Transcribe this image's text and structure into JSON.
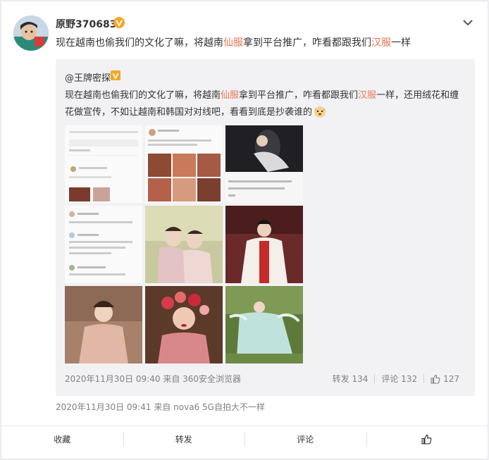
{
  "post": {
    "username": "原野370683",
    "text_parts": [
      "现在越南也偷我们的文化了嘛，将越南",
      "仙服",
      "拿到平台推广，咋看都跟我们",
      "汉服",
      "一样"
    ],
    "timestamp": "2020年11月30日 09:41",
    "source_label": "来自",
    "source": "nova6 5G自拍大不一样"
  },
  "repost": {
    "username": "@王牌密探",
    "text_parts": [
      "现在越南也偷我们的文化了嘛，将越南",
      "仙服",
      "拿到平台推广，咋看都跟我们",
      "汉服",
      "一样，还用绒花和缠花做宣传，不如让越南和韩国对对线吧，看看到底是抄袭谁的"
    ],
    "timestamp": "2020年11月30日 09:40",
    "source_label": "来自",
    "source": "360安全浏览器",
    "forward_label": "转发 134",
    "comment_label": "评论 132",
    "likes": "127"
  },
  "actions": {
    "favorite": "收藏",
    "forward": "转发",
    "comment": "评论"
  },
  "colors": {
    "highlight": "#eb7350",
    "badge": "#f5a623"
  }
}
